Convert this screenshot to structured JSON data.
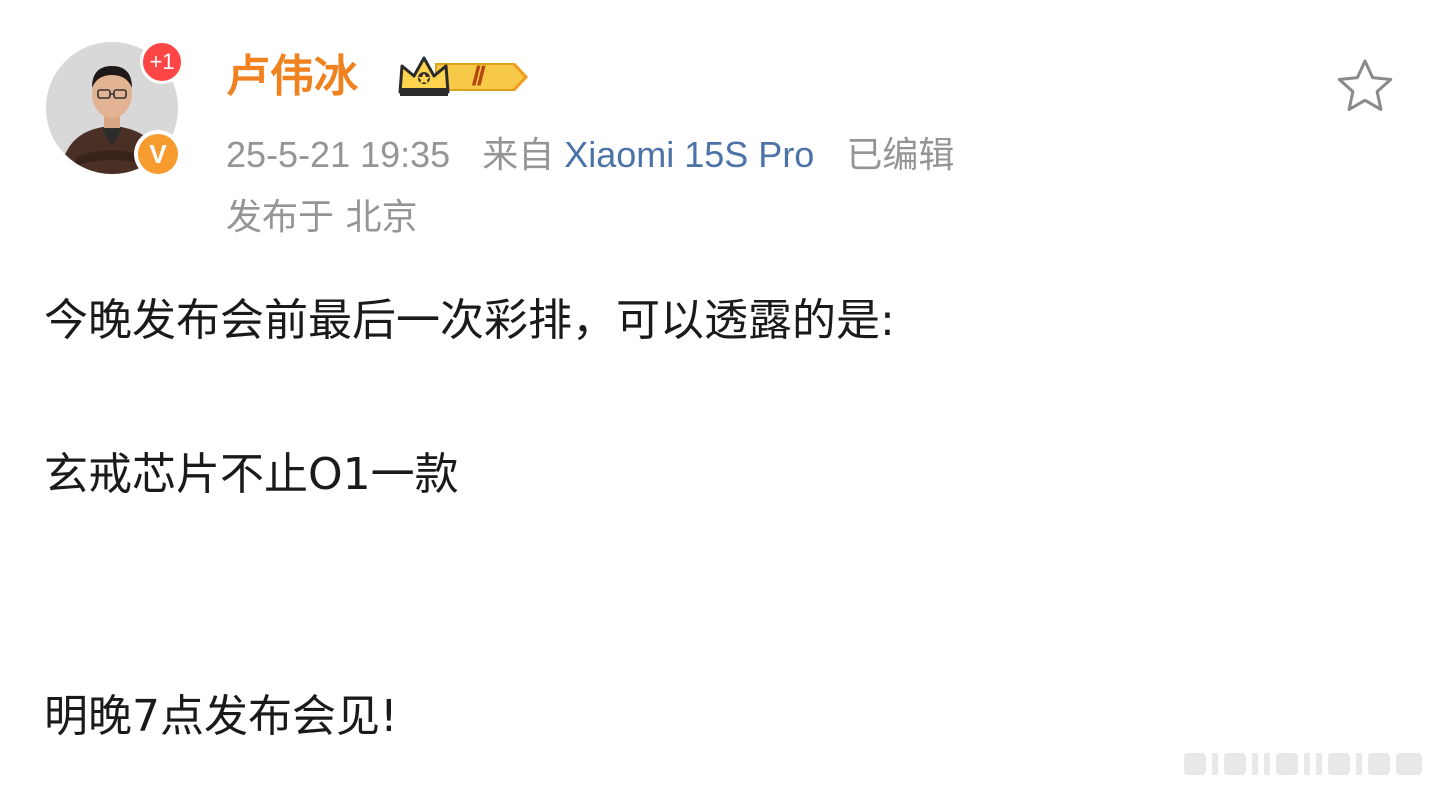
{
  "author": {
    "name": "卢伟冰",
    "notification_badge": "+1",
    "verified_badge": "V",
    "level_badge": "Ⅱ",
    "verified_color": "#f79b2e",
    "name_color": "#f0811f"
  },
  "meta": {
    "time": "25-5-21 19:35",
    "source_prefix": "来自",
    "device": "Xiaomi 15S Pro",
    "edited": "已编辑",
    "location": "发布于 北京",
    "device_color": "#4c73a8"
  },
  "post": {
    "lines": [
      "今晚发布会前最后一次彩排，可以透露的是:",
      "玄戒芯片不止O1一款",
      "明晚7点发布会见!"
    ]
  },
  "icons": {
    "favorite": "star-outline-icon",
    "crown": "crown-level-icon"
  }
}
